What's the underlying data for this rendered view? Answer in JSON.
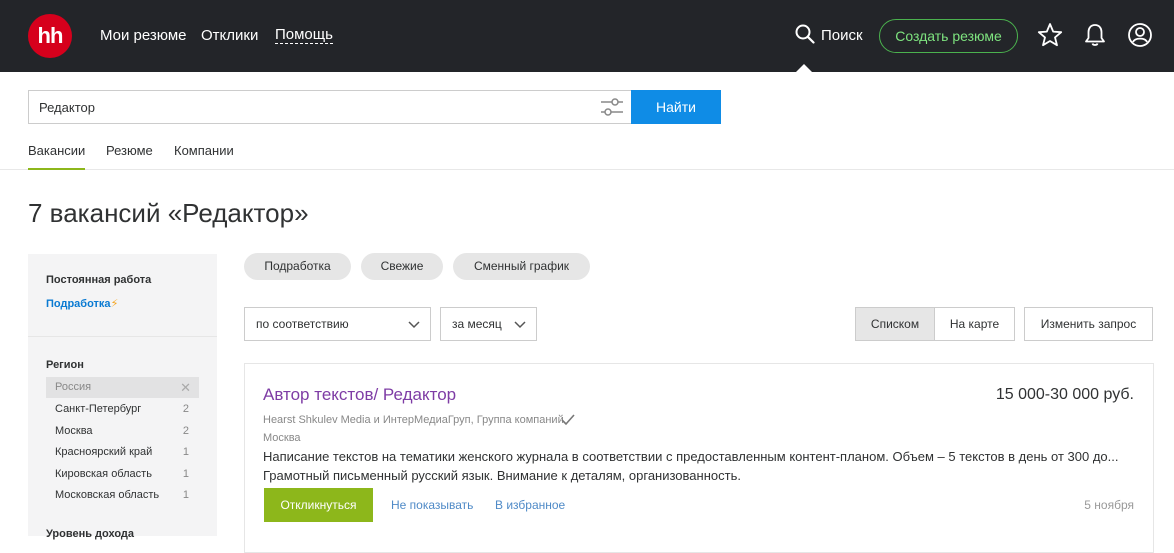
{
  "header": {
    "logo": "hh",
    "nav": [
      "Мои резюме",
      "Отклики",
      "Помощь"
    ],
    "search_label": "Поиск",
    "create_resume": "Создать резюме"
  },
  "search": {
    "query": "Редактор",
    "find_button": "Найти",
    "tabs": [
      "Вакансии",
      "Резюме",
      "Компании"
    ]
  },
  "page": {
    "title": "7 вакансий «Редактор»"
  },
  "sidebar": {
    "job_type_heading": "Постоянная работа",
    "job_type_link": "Подработка",
    "job_type_link_icon": "⚡",
    "region_heading": "Регион",
    "regions": [
      {
        "name": "Россия",
        "count": ""
      },
      {
        "name": "Санкт-Петербург",
        "count": "2"
      },
      {
        "name": "Москва",
        "count": "2"
      },
      {
        "name": "Красноярский край",
        "count": "1"
      },
      {
        "name": "Кировская область",
        "count": "1"
      },
      {
        "name": "Московская область",
        "count": "1"
      }
    ],
    "income_heading": "Уровень дохода"
  },
  "filters": {
    "chips": [
      "Подработка",
      "Свежие",
      "Сменный график"
    ],
    "sort": "по соответствию",
    "period": "за месяц",
    "view_list": "Списком",
    "view_map": "На карте",
    "edit_query": "Изменить запрос"
  },
  "vacancy": {
    "title": "Автор текстов/ Редактор",
    "salary": "15 000-30 000 руб.",
    "company": "Hearst Shkulev Media и ИнтерМедиаГруп, Группа компаний",
    "city": "Москва",
    "desc_line1": "Написание текстов на тематики женского журнала в соответствии с предоставленным контент-планом. Объем – 5 текстов в день от 300 до...",
    "desc_line2": "Грамотный письменный русский язык. Внимание к деталям, организованность.",
    "apply": "Откликнуться",
    "hide": "Не показывать",
    "favorite": "В избранное",
    "date": "5 ноября"
  },
  "colors": {
    "topbar": "#232529",
    "logo": "#d6001c",
    "primary_button": "#0f8ce6",
    "apply_button": "#8db71b",
    "vacancy_title": "#7e3ca5",
    "create_resume": "#7ee37f"
  }
}
